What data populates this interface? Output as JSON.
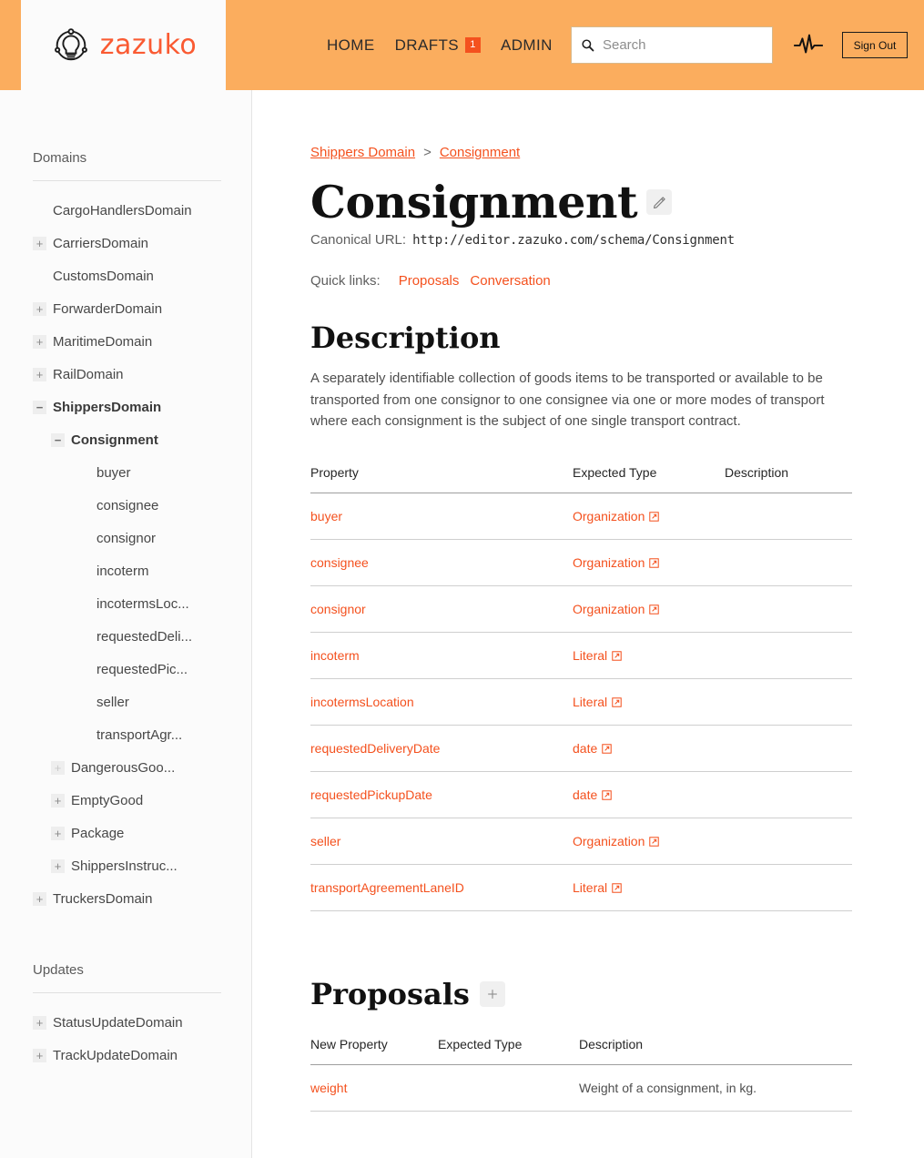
{
  "header": {
    "logo_text": "zazuko",
    "logo_icon": "lightbulb-network-icon",
    "nav": [
      {
        "label": "HOME",
        "name": "home"
      },
      {
        "label": "DRAFTS",
        "name": "drafts",
        "badge": "1"
      },
      {
        "label": "ADMIN",
        "name": "admin"
      }
    ],
    "search": {
      "placeholder": "Search",
      "value": "",
      "icon": "search-icon"
    },
    "pulse_icon": "activity-pulse-icon",
    "signout_label": "Sign Out"
  },
  "sidebar": {
    "domains_title": "Domains",
    "updates_title": "Updates",
    "domains": [
      {
        "label": "CargoHandlersDomain",
        "toggle": "",
        "indent": 0,
        "bold": false
      },
      {
        "label": "CarriersDomain",
        "toggle": "+",
        "indent": 0,
        "bold": false
      },
      {
        "label": "CustomsDomain",
        "toggle": "",
        "indent": 0,
        "bold": false
      },
      {
        "label": "ForwarderDomain",
        "toggle": "+",
        "indent": 0,
        "bold": false
      },
      {
        "label": "MaritimeDomain",
        "toggle": "+",
        "indent": 0,
        "bold": false
      },
      {
        "label": "RailDomain",
        "toggle": "+",
        "indent": 0,
        "bold": false
      },
      {
        "label": "ShippersDomain",
        "toggle": "−",
        "indent": 0,
        "bold": true
      },
      {
        "label": "Consignment",
        "toggle": "−",
        "indent": 1,
        "bold": true
      },
      {
        "label": "buyer",
        "toggle": "",
        "indent": 2,
        "bold": false
      },
      {
        "label": "consignee",
        "toggle": "",
        "indent": 2,
        "bold": false
      },
      {
        "label": "consignor",
        "toggle": "",
        "indent": 2,
        "bold": false
      },
      {
        "label": "incoterm",
        "toggle": "",
        "indent": 2,
        "bold": false
      },
      {
        "label": "incotermsLoc...",
        "toggle": "",
        "indent": 2,
        "bold": false
      },
      {
        "label": "requestedDeli...",
        "toggle": "",
        "indent": 2,
        "bold": false
      },
      {
        "label": "requestedPic...",
        "toggle": "",
        "indent": 2,
        "bold": false
      },
      {
        "label": "seller",
        "toggle": "",
        "indent": 2,
        "bold": false
      },
      {
        "label": "transportAgr...",
        "toggle": "",
        "indent": 2,
        "bold": false
      },
      {
        "label": "DangerousGoo...",
        "toggle": "+",
        "indent": 1,
        "bold": false,
        "faint": true
      },
      {
        "label": "EmptyGood",
        "toggle": "+",
        "indent": 1,
        "bold": false
      },
      {
        "label": "Package",
        "toggle": "+",
        "indent": 1,
        "bold": false
      },
      {
        "label": "ShippersInstruc...",
        "toggle": "+",
        "indent": 1,
        "bold": false
      },
      {
        "label": "TruckersDomain",
        "toggle": "+",
        "indent": 0,
        "bold": false
      }
    ],
    "updates": [
      {
        "label": "StatusUpdateDomain",
        "toggle": "+",
        "indent": 0,
        "bold": false
      },
      {
        "label": "TrackUpdateDomain",
        "toggle": "+",
        "indent": 0,
        "bold": false
      }
    ]
  },
  "main": {
    "breadcrumb": {
      "parent": "Shippers Domain",
      "separator": ">",
      "current": "Consignment"
    },
    "title": "Consignment",
    "edit_icon": "pencil-edit-icon",
    "canonical_label": "Canonical URL:",
    "canonical_url": "http://editor.zazuko.com/schema/Consignment",
    "quick_links_label": "Quick links:",
    "quick_links": [
      {
        "label": "Proposals"
      },
      {
        "label": "Conversation"
      }
    ],
    "description_heading": "Description",
    "description_text": "A separately identifiable collection of goods items to be transported or available to be transported from one consignor to one consignee via one or more modes of transport where each consignment is the subject of one single transport contract.",
    "properties_table": {
      "columns": [
        "Property",
        "Expected Type",
        "Description"
      ],
      "rows": [
        {
          "property": "buyer",
          "type": "Organization",
          "description": ""
        },
        {
          "property": "consignee",
          "type": "Organization",
          "description": ""
        },
        {
          "property": "consignor",
          "type": "Organization",
          "description": ""
        },
        {
          "property": "incoterm",
          "type": "Literal",
          "description": ""
        },
        {
          "property": "incotermsLocation",
          "type": "Literal",
          "description": ""
        },
        {
          "property": "requestedDeliveryDate",
          "type": "date",
          "description": ""
        },
        {
          "property": "requestedPickupDate",
          "type": "date",
          "description": ""
        },
        {
          "property": "seller",
          "type": "Organization",
          "description": ""
        },
        {
          "property": "transportAgreementLaneID",
          "type": "Literal",
          "description": ""
        }
      ]
    },
    "proposals_heading": "Proposals",
    "proposals_add_icon": "plus-add-icon",
    "proposals_table": {
      "columns": [
        "New Property",
        "Expected Type",
        "Description"
      ],
      "rows": [
        {
          "property": "weight",
          "type": "",
          "description": "Weight of a consignment, in kg."
        }
      ]
    }
  },
  "colors": {
    "header_orange": "#fbad5e",
    "accent_orange": "#f4511e",
    "logo_orange": "#fa5a32",
    "sidebar_bg": "#fbfbfb"
  }
}
